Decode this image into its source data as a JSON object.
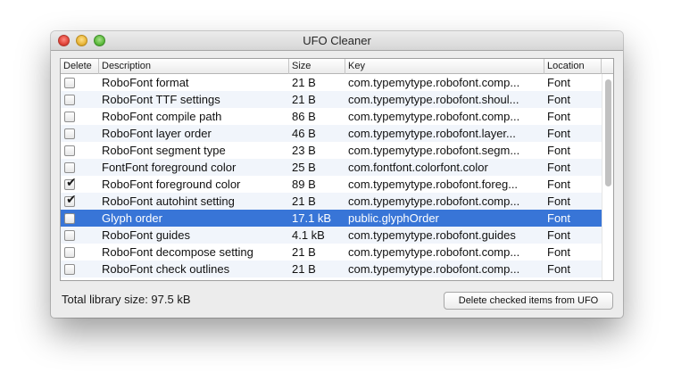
{
  "window": {
    "title": "UFO Cleaner"
  },
  "table": {
    "columns": {
      "delete": "Delete",
      "description": "Description",
      "size": "Size",
      "key": "Key",
      "location": "Location"
    },
    "rows": [
      {
        "checked": false,
        "description": "RoboFont format",
        "size": "21 B",
        "key": "com.typemytype.robofont.comp...",
        "location": "Font"
      },
      {
        "checked": false,
        "description": "RoboFont TTF settings",
        "size": "21 B",
        "key": "com.typemytype.robofont.shoul...",
        "location": "Font"
      },
      {
        "checked": false,
        "description": "RoboFont compile path",
        "size": "86 B",
        "key": "com.typemytype.robofont.comp...",
        "location": "Font"
      },
      {
        "checked": false,
        "description": "RoboFont layer order",
        "size": "46 B",
        "key": "com.typemytype.robofont.layer...",
        "location": "Font"
      },
      {
        "checked": false,
        "description": "RoboFont segment type",
        "size": "23 B",
        "key": "com.typemytype.robofont.segm...",
        "location": "Font"
      },
      {
        "checked": false,
        "description": "FontFont foreground color",
        "size": "25 B",
        "key": "com.fontfont.colorfont.color",
        "location": "Font"
      },
      {
        "checked": true,
        "description": "RoboFont foreground color",
        "size": "89 B",
        "key": "com.typemytype.robofont.foreg...",
        "location": "Font"
      },
      {
        "checked": true,
        "description": "RoboFont autohint setting",
        "size": "21 B",
        "key": "com.typemytype.robofont.comp...",
        "location": "Font"
      },
      {
        "checked": false,
        "description": "Glyph order",
        "size": "17.1 kB",
        "key": "public.glyphOrder",
        "location": "Font",
        "selected": true
      },
      {
        "checked": false,
        "description": "RoboFont guides",
        "size": "4.1 kB",
        "key": "com.typemytype.robofont.guides",
        "location": "Font"
      },
      {
        "checked": false,
        "description": "RoboFont decompose setting",
        "size": "21 B",
        "key": "com.typemytype.robofont.comp...",
        "location": "Font"
      },
      {
        "checked": false,
        "description": "RoboFont check outlines",
        "size": "21 B",
        "key": "com.typemytype.robofont.comp...",
        "location": "Font"
      }
    ]
  },
  "footer": {
    "total_label": "Total library size: 97.5 kB",
    "delete_button": "Delete checked items from UFO"
  },
  "colors": {
    "selection": "#3875d7",
    "alternate_row": "#f1f5fb"
  }
}
